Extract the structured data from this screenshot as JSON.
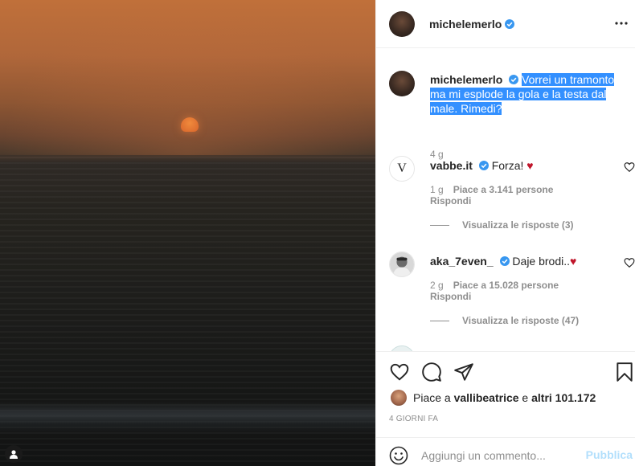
{
  "post": {
    "author": "michelemerlo",
    "caption": "Vorrei un tramonto ma mi esplode la gola e la testa dal male. Rimedi?",
    "caption_time": "4 g",
    "likes_prefix": "Piace a ",
    "likes_user": "vallibeatrice",
    "likes_middle": " e ",
    "likes_rest": "altri 101.172",
    "date": "4 GIORNI FA"
  },
  "comments": [
    {
      "user": "vabbe.it",
      "text": "Forza! ",
      "emoji": "♥",
      "time": "1 g",
      "likes": "Piace a 3.141 persone",
      "reply": "Rispondi",
      "view_replies": "Visualizza le risposte (3)"
    },
    {
      "user": "aka_7even_",
      "text": "Daje brodi..",
      "emoji": "♥",
      "time": "2 g",
      "likes": "Piace a 15.028 persone",
      "reply": "Rispondi",
      "view_replies": "Visualizza le risposte (47)"
    }
  ],
  "comment_box": {
    "placeholder": "Aggiungi un commento...",
    "publish_label": "Pubblica"
  },
  "colors": {
    "verified": "#3897f0",
    "heart": "#c0162b",
    "publish_disabled": "#b2dffc"
  },
  "icons": {
    "header_more": "more-dots-icon",
    "like": "heart-outline-icon",
    "comment": "comment-bubble-icon",
    "share": "paper-plane-icon",
    "save": "bookmark-icon",
    "emoji": "smiley-icon",
    "user_tag": "user-silhouette-icon"
  }
}
